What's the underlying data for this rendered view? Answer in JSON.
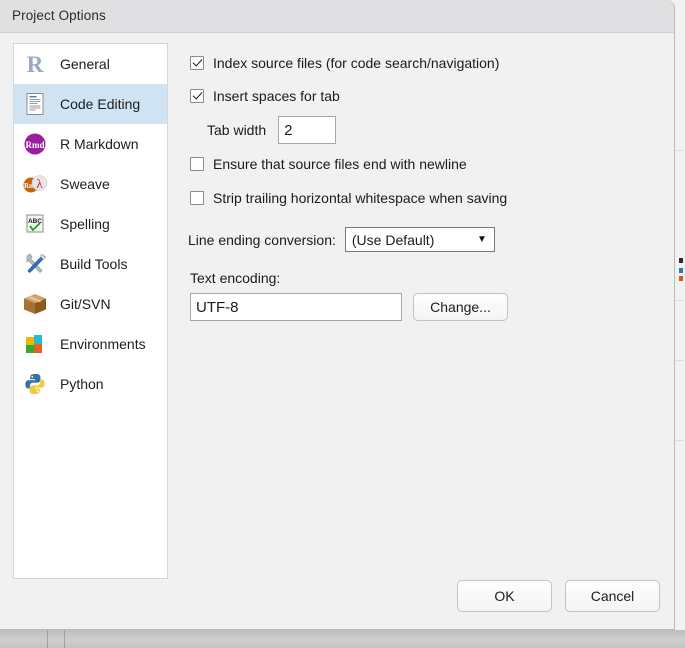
{
  "window": {
    "title": "Project Options"
  },
  "sidebar": {
    "items": [
      {
        "label": "General",
        "icon": "r-logo-icon",
        "selected": false
      },
      {
        "label": "Code Editing",
        "icon": "document-icon",
        "selected": true
      },
      {
        "label": "R Markdown",
        "icon": "rmd-icon",
        "selected": false
      },
      {
        "label": "Sweave",
        "icon": "rnw-pdf-icon",
        "selected": false
      },
      {
        "label": "Spelling",
        "icon": "abc-check-icon",
        "selected": false
      },
      {
        "label": "Build Tools",
        "icon": "wrench-screwdriver-icon",
        "selected": false
      },
      {
        "label": "Git/SVN",
        "icon": "package-box-icon",
        "selected": false
      },
      {
        "label": "Environments",
        "icon": "color-blocks-icon",
        "selected": false
      },
      {
        "label": "Python",
        "icon": "python-icon",
        "selected": false
      }
    ]
  },
  "options": {
    "index_source_files": {
      "label": "Index source files (for code search/navigation)",
      "checked": true
    },
    "insert_spaces": {
      "label": "Insert spaces for tab",
      "checked": true
    },
    "tab_width": {
      "label": "Tab width",
      "value": "2"
    },
    "ensure_newline": {
      "label": "Ensure that source files end with newline",
      "checked": false
    },
    "strip_trailing": {
      "label": "Strip trailing horizontal whitespace when saving",
      "checked": false
    },
    "line_ending": {
      "label": "Line ending conversion:",
      "value": "(Use Default)",
      "arrow": "▼"
    },
    "text_encoding": {
      "label": "Text encoding:",
      "value": "UTF-8",
      "change_button": "Change..."
    }
  },
  "buttons": {
    "ok": "OK",
    "cancel": "Cancel"
  },
  "colors": {
    "selection": "#cfe3f3",
    "titlebar": "#e0e0e3",
    "dialog_bg": "#f1f1f1"
  }
}
